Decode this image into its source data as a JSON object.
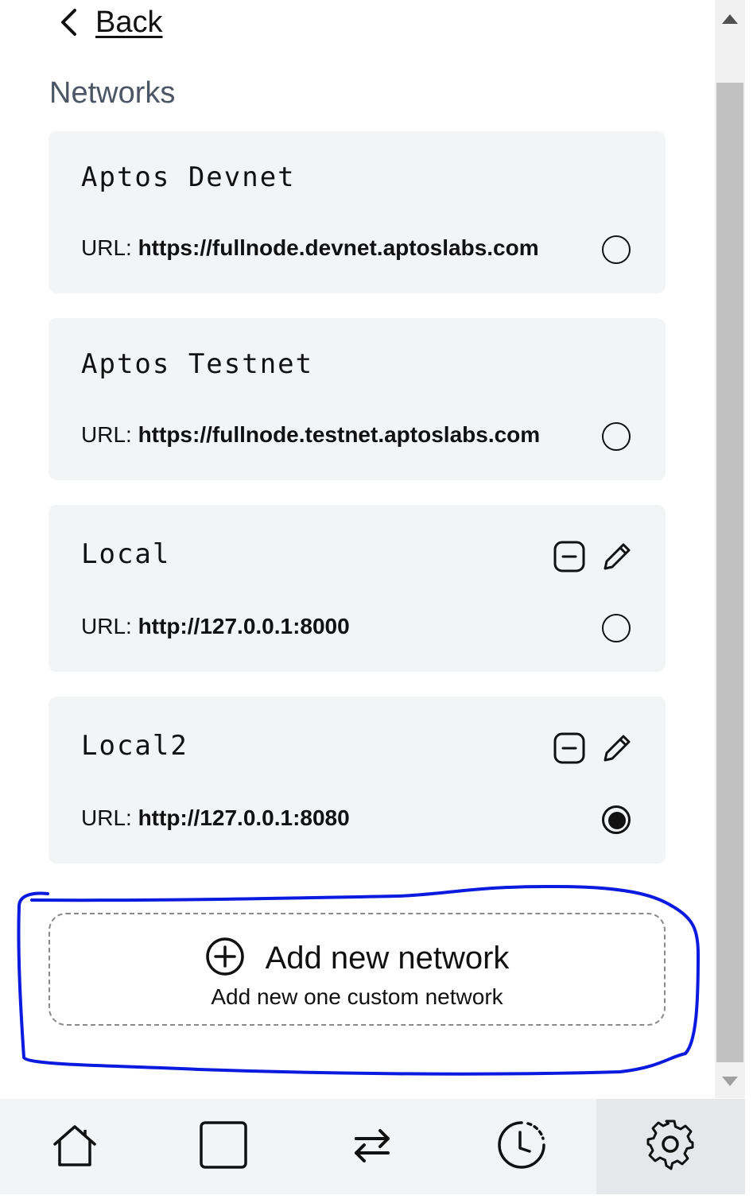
{
  "back": {
    "label": "Back"
  },
  "section_title": "Networks",
  "networks": [
    {
      "name": "Aptos Devnet",
      "url_prefix": "URL:",
      "url": "https://fullnode.devnet.aptoslabs.com",
      "selected": false,
      "editable": false
    },
    {
      "name": "Aptos Testnet",
      "url_prefix": "URL:",
      "url": "https://fullnode.testnet.aptoslabs.com",
      "selected": false,
      "editable": false
    },
    {
      "name": "Local",
      "url_prefix": "URL:",
      "url": "http://127.0.0.1:8000",
      "selected": false,
      "editable": true
    },
    {
      "name": "Local2",
      "url_prefix": "URL:",
      "url": "http://127.0.0.1:8080",
      "selected": true,
      "editable": true
    }
  ],
  "add_network": {
    "title": "Add new network",
    "subtitle": "Add new one custom network"
  },
  "bottom_nav": [
    {
      "icon": "home-icon",
      "active": false
    },
    {
      "icon": "square-icon",
      "active": false
    },
    {
      "icon": "transfer-arrows-icon",
      "active": false
    },
    {
      "icon": "clock-history-icon",
      "active": false
    },
    {
      "icon": "gear-icon",
      "active": true
    }
  ],
  "colors": {
    "card_bg": "#f3f4f6",
    "highlight_stroke": "#0a1adf",
    "nav_bg": "#f3f4f6",
    "nav_active_bg": "#e5e7eb",
    "title_gray": "#4b5563"
  }
}
